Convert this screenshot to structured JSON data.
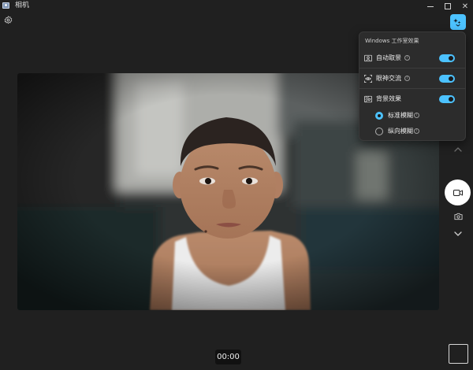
{
  "window": {
    "title": "相机",
    "minimize_glyph": "",
    "maximize_glyph": "",
    "close_glyph": "✕"
  },
  "flyout": {
    "title": "Windows 工作室效果",
    "items": [
      {
        "label": "自动取景",
        "icon": "auto-framing-icon",
        "enabled": true
      },
      {
        "label": "眼神交流",
        "icon": "eye-contact-icon",
        "enabled": true
      },
      {
        "label": "背景效果",
        "icon": "background-effects-icon",
        "enabled": true
      }
    ],
    "blur_options": [
      {
        "label": "标准模糊",
        "selected": true
      },
      {
        "label": "纵向模糊",
        "selected": false
      }
    ],
    "info_glyph": "i"
  },
  "recording": {
    "timer": "00:00"
  },
  "colors": {
    "accent": "#4cc2ff",
    "background": "#202020",
    "panel": "#2c2c2c"
  },
  "icons": [
    "settings-icon",
    "studio-effects-icon",
    "chevron-up-icon",
    "video-camera-icon",
    "camera-icon",
    "chevron-down-icon"
  ]
}
